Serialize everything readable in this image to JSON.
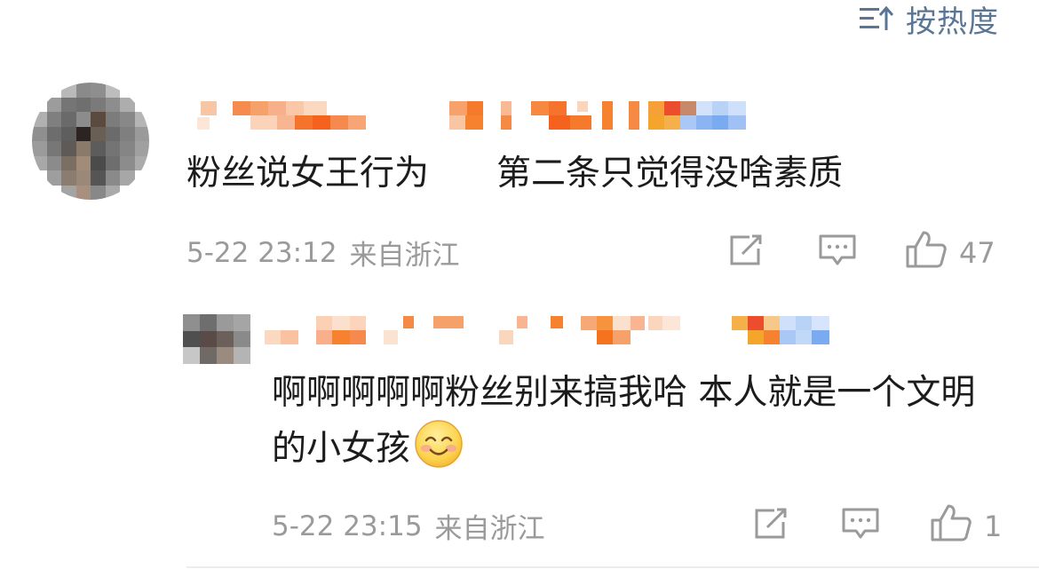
{
  "sort": {
    "label": "按热度",
    "icon": "sort-icon"
  },
  "comments": [
    {
      "text_a": "粉丝说女王行为",
      "text_b": "第二条只觉得没啥素质",
      "date": "5-22 23:12",
      "source": "来自浙江",
      "like_count": "47"
    },
    {
      "text": "啊啊啊啊啊粉丝别来搞我哈 本人就是一个文明的小女孩",
      "date": "5-22 23:15",
      "source": "来自浙江",
      "like_count": "1",
      "emoji": "smiling-face-icon"
    }
  ],
  "icons": {
    "share": "share-icon",
    "reply": "comment-icon",
    "like": "thumbs-up-icon"
  },
  "colors": {
    "link_blue": "#5b7695",
    "meta_gray": "#9a9a9a",
    "text": "#1c1c1c"
  }
}
